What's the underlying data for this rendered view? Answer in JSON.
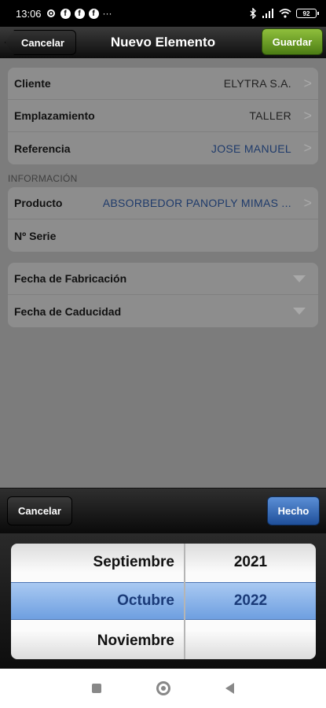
{
  "status_bar": {
    "time": "13:06",
    "battery": "92",
    "icons": [
      "settings-icon",
      "facebook-icon",
      "facebook-icon",
      "facebook-icon",
      "more-icon",
      "bluetooth-icon",
      "signal-icon",
      "wifi-icon",
      "battery-icon"
    ],
    "fb_glyph": "f",
    "more_glyph": "···"
  },
  "nav": {
    "title": "Nuevo Elemento",
    "cancel_label": "Cancelar",
    "save_label": "Guardar"
  },
  "details": {
    "rows": [
      {
        "label": "Cliente",
        "value": "ELYTRA S.A."
      },
      {
        "label": "Emplazamiento",
        "value": "TALLER"
      },
      {
        "label": "Referencia",
        "value": "JOSE MANUEL"
      }
    ],
    "chevron": ">"
  },
  "info_section": {
    "header": "INFORMACIÓN",
    "rows": [
      {
        "label": "Producto",
        "value": "ABSORBEDOR PANOPLY MIMAS ..."
      },
      {
        "label": "Nº Serie",
        "value": ""
      }
    ]
  },
  "dates": {
    "rows": [
      {
        "label": "Fecha de Fabricación"
      },
      {
        "label": "Fecha de Caducidad"
      }
    ]
  },
  "picker_toolbar": {
    "cancel_label": "Cancelar",
    "done_label": "Hecho"
  },
  "picker": {
    "months": [
      "Septiembre",
      "Octubre",
      "Noviembre"
    ],
    "years": [
      "2021",
      "2022",
      ""
    ],
    "selected_month": "Octubre",
    "selected_year": "2022"
  },
  "colors": {
    "save_button": "#6a9e28",
    "done_button": "#3a6fbf",
    "selection_band": "#8cb6ea",
    "link_value": "#1f3b6b"
  }
}
